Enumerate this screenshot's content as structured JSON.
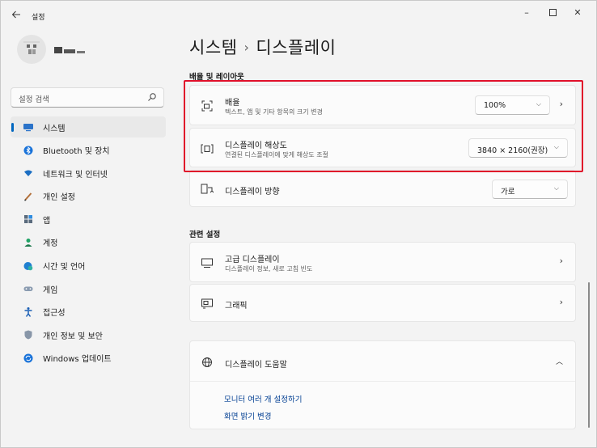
{
  "window": {
    "title": "설정",
    "controls": {
      "minimize": "–",
      "maximize": "☐",
      "close": "✕"
    }
  },
  "sidebar": {
    "search_placeholder": "설정 검색",
    "items": [
      {
        "label": "시스템",
        "icon": "monitor-icon",
        "active": true
      },
      {
        "label": "Bluetooth 및 장치",
        "icon": "bluetooth-icon"
      },
      {
        "label": "네트워크 및 인터넷",
        "icon": "wifi-icon"
      },
      {
        "label": "개인 설정",
        "icon": "pen-icon"
      },
      {
        "label": "앱",
        "icon": "apps-icon"
      },
      {
        "label": "계정",
        "icon": "person-icon"
      },
      {
        "label": "시간 및 언어",
        "icon": "globe-clock-icon"
      },
      {
        "label": "게임",
        "icon": "gamepad-icon"
      },
      {
        "label": "접근성",
        "icon": "accessibility-icon"
      },
      {
        "label": "개인 정보 및 보안",
        "icon": "shield-icon"
      },
      {
        "label": "Windows 업데이트",
        "icon": "update-icon"
      }
    ]
  },
  "main": {
    "breadcrumb_parent": "시스템",
    "breadcrumb_sep": "›",
    "breadcrumb_current": "디스플레이",
    "section_scale_layout": "배율 및 레이아웃",
    "scale": {
      "title": "배율",
      "subtitle": "텍스트, 앱 및 기타 항목의 크기 변경",
      "value": "100%"
    },
    "resolution": {
      "title": "디스플레이 해상도",
      "subtitle": "연결된 디스플레이에 맞게 해상도 조절",
      "value": "3840 × 2160(권장)"
    },
    "orientation": {
      "title": "디스플레이 방향",
      "value": "가로"
    },
    "section_related": "관련 설정",
    "advanced": {
      "title": "고급 디스플레이",
      "subtitle": "디스플레이 정보, 새로 고침 빈도"
    },
    "graphics": {
      "title": "그래픽"
    },
    "help": {
      "title": "디스플레이 도움말",
      "links": [
        "모니터 여러 개 설정하기",
        "화면 밝기 변경"
      ]
    }
  },
  "colors": {
    "accent": "#0067c0",
    "highlight": "#e0102a",
    "link": "#003e92"
  }
}
